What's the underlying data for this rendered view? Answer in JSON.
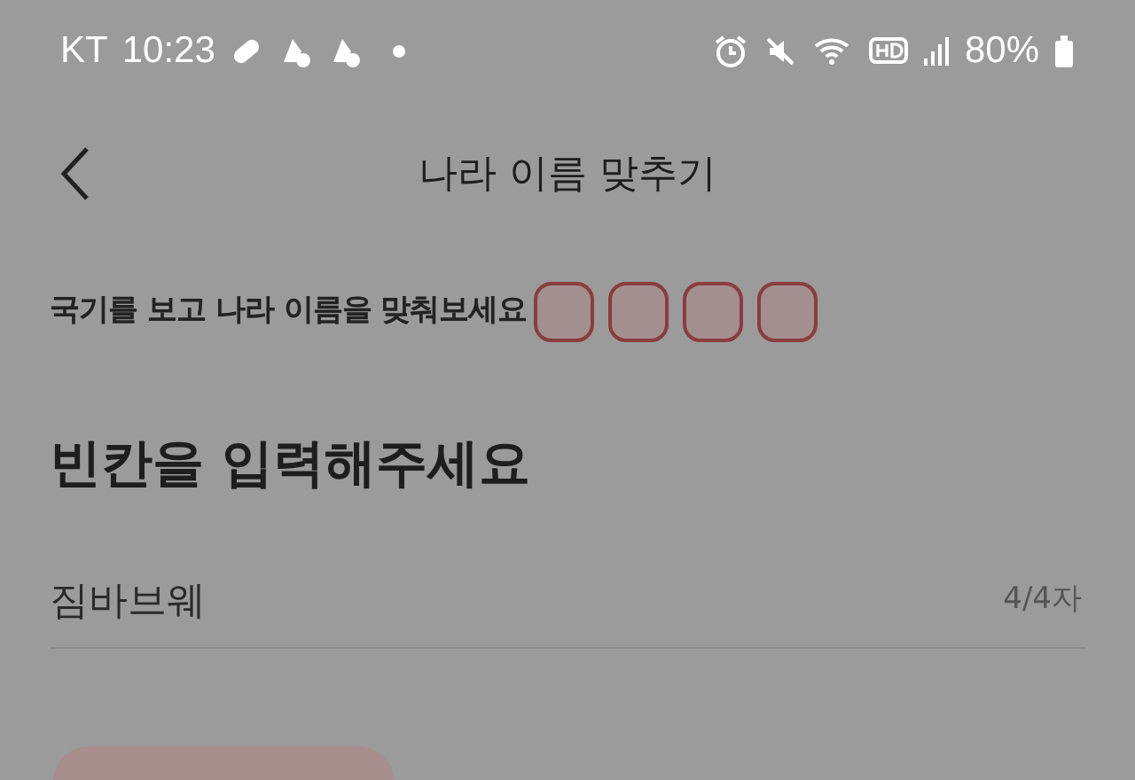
{
  "status_bar": {
    "carrier": "KT",
    "time": "10:23",
    "battery": "80%"
  },
  "header": {
    "title": "나라 이름 맞추기"
  },
  "prompt": {
    "text": "국기를 보고 나라 이름을 맞춰보세요",
    "slots": [
      {
        "filled": false
      },
      {
        "filled": false
      },
      {
        "filled": false
      },
      {
        "filled": false
      }
    ]
  },
  "heading": "빈칸을 입력해주세요",
  "answer_field": {
    "value": "짐바브웨",
    "counter": "4/4자"
  }
}
